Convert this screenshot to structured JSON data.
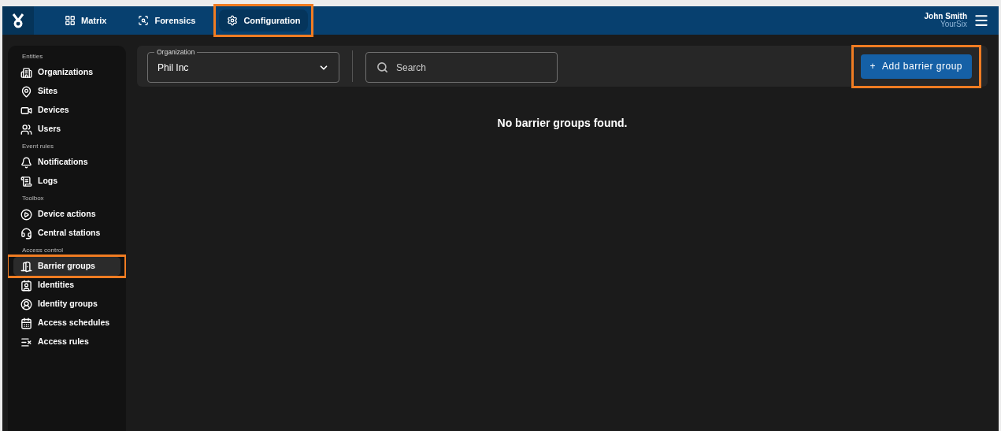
{
  "topbar": {
    "nav": [
      {
        "label": "Matrix",
        "selected": false,
        "highlighted": false
      },
      {
        "label": "Forensics",
        "selected": false,
        "highlighted": false
      },
      {
        "label": "Configuration",
        "selected": true,
        "highlighted": true
      }
    ],
    "user": {
      "name": "John Smith",
      "company": "YourSix"
    }
  },
  "sidebar": {
    "sections": [
      {
        "title": "Entities",
        "items": [
          {
            "label": "Organizations",
            "selected": false,
            "highlighted": false
          },
          {
            "label": "Sites",
            "selected": false,
            "highlighted": false
          },
          {
            "label": "Devices",
            "selected": false,
            "highlighted": false
          },
          {
            "label": "Users",
            "selected": false,
            "highlighted": false
          }
        ]
      },
      {
        "title": "Event rules",
        "items": [
          {
            "label": "Notifications",
            "selected": false,
            "highlighted": false
          },
          {
            "label": "Logs",
            "selected": false,
            "highlighted": false
          }
        ]
      },
      {
        "title": "Toolbox",
        "items": [
          {
            "label": "Device actions",
            "selected": false,
            "highlighted": false
          },
          {
            "label": "Central stations",
            "selected": false,
            "highlighted": false
          }
        ]
      },
      {
        "title": "Access control",
        "items": [
          {
            "label": "Barrier groups",
            "selected": true,
            "highlighted": true
          },
          {
            "label": "Identities",
            "selected": false,
            "highlighted": false
          },
          {
            "label": "Identity groups",
            "selected": false,
            "highlighted": false
          },
          {
            "label": "Access schedules",
            "selected": false,
            "highlighted": false
          },
          {
            "label": "Access rules",
            "selected": false,
            "highlighted": false
          }
        ]
      }
    ]
  },
  "toolbar": {
    "organization": {
      "label": "Organization",
      "value": "Phil Inc"
    },
    "search": {
      "placeholder": "Search"
    },
    "add_button": {
      "label": "Add barrier group",
      "icon": "+",
      "highlighted": true
    }
  },
  "empty_message": "No barrier groups found."
}
